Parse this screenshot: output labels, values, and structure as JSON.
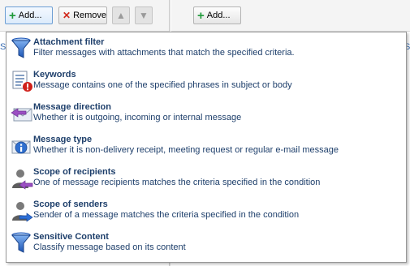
{
  "left_toolbar": {
    "add_label": "Add...",
    "remove_label": "Remove"
  },
  "right_toolbar": {
    "add_label": "Add..."
  },
  "left_fragment": "S",
  "right_fragment": "S",
  "menu": {
    "items": [
      {
        "title": "Attachment filter",
        "description": "Filter messages with attachments that match the specified criteria.",
        "icon": "funnel-icon"
      },
      {
        "title": "Keywords",
        "description": "Message contains one of the specified phrases in subject or body",
        "icon": "keywords-document-icon"
      },
      {
        "title": "Message direction",
        "description": "Whether it is outgoing, incoming or internal message",
        "icon": "message-direction-icon"
      },
      {
        "title": "Message type",
        "description": "Whether it is non-delivery receipt, meeting request or regular e-mail message",
        "icon": "message-type-info-icon"
      },
      {
        "title": "Scope of recipients",
        "description": "One of message recipients matches the criteria specified in the condition",
        "icon": "recipients-user-icon"
      },
      {
        "title": "Scope of senders",
        "description": "Sender of a message matches the criteria specified in the condition",
        "icon": "senders-user-icon"
      },
      {
        "title": "Sensitive Content",
        "description": "Classify message based on its content",
        "icon": "sensitive-content-funnel-icon"
      }
    ]
  },
  "colors": {
    "item_text": "#1e3f6b",
    "add_green": "#1f9a3a",
    "remove_red": "#d12a1c",
    "funnel_blue": "#2f6fcf",
    "arrow_purple": "#9b4fc3",
    "arrow_blue": "#2d6fd6"
  }
}
